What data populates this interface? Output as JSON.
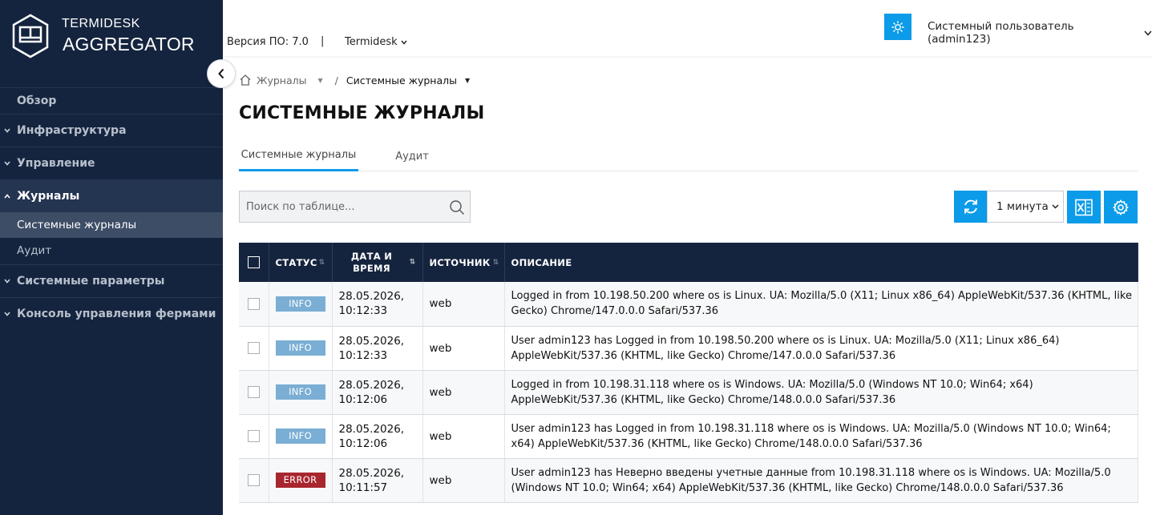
{
  "brand": {
    "line1": "TERMIDESK",
    "line2": "AGGREGATOR"
  },
  "sidebar": {
    "items": [
      {
        "label": "Обзор"
      },
      {
        "label": "Инфраструктура"
      },
      {
        "label": "Управление"
      },
      {
        "label": "Журналы",
        "expanded": true
      },
      {
        "label": "Системные параметры"
      },
      {
        "label": "Консоль управления фермами"
      }
    ],
    "journal_sub": [
      {
        "label": "Системные журналы",
        "active": true
      },
      {
        "label": "Аудит"
      }
    ]
  },
  "header": {
    "version": "Версия ПО: 7.0",
    "separator": "|",
    "org": "Termidesk",
    "user": "Системный пользователь (admin123)"
  },
  "breadcrumb": {
    "parent": "Журналы",
    "separator": "/",
    "current": "Системные журналы"
  },
  "page_title": "СИСТЕМНЫЕ ЖУРНАЛЫ",
  "tabs": [
    {
      "label": "Системные журналы",
      "active": true
    },
    {
      "label": "Аудит"
    }
  ],
  "search": {
    "placeholder": "Поиск по таблице..."
  },
  "toolbar": {
    "interval": "1 минута"
  },
  "table": {
    "columns": {
      "status": "СТАТУС",
      "date": "ДАТА И ВРЕМЯ",
      "source": "ИСТОЧНИК",
      "description": "ОПИСАНИЕ"
    },
    "rows": [
      {
        "status": "INFO",
        "level": "info",
        "date": "28.05.2026,",
        "time": "10:12:33",
        "source": "web",
        "description": "Logged in from 10.198.50.200 where os is Linux. UA: Mozilla/5.0 (X11; Linux x86_64) AppleWebKit/537.36 (KHTML, like Gecko) Chrome/147.0.0.0 Safari/537.36"
      },
      {
        "status": "INFO",
        "level": "info",
        "date": "28.05.2026,",
        "time": "10:12:33",
        "source": "web",
        "description": "User admin123 has Logged in from 10.198.50.200 where os is Linux. UA: Mozilla/5.0 (X11; Linux x86_64) AppleWebKit/537.36 (KHTML, like Gecko) Chrome/147.0.0.0 Safari/537.36"
      },
      {
        "status": "INFO",
        "level": "info",
        "date": "28.05.2026,",
        "time": "10:12:06",
        "source": "web",
        "description": "Logged in from 10.198.31.118 where os is Windows. UA: Mozilla/5.0 (Windows NT 10.0; Win64; x64) AppleWebKit/537.36 (KHTML, like Gecko) Chrome/148.0.0.0 Safari/537.36"
      },
      {
        "status": "INFO",
        "level": "info",
        "date": "28.05.2026,",
        "time": "10:12:06",
        "source": "web",
        "description": "User admin123 has Logged in from 10.198.31.118 where os is Windows. UA: Mozilla/5.0 (Windows NT 10.0; Win64; x64) AppleWebKit/537.36 (KHTML, like Gecko) Chrome/148.0.0.0 Safari/537.36"
      },
      {
        "status": "ERROR",
        "level": "error",
        "date": "28.05.2026,",
        "time": "10:11:57",
        "source": "web",
        "description": "User admin123 has Неверно введены учетные данные from 10.198.31.118 where os is Windows. UA: Mozilla/5.0 (Windows NT 10.0; Win64; x64) AppleWebKit/537.36 (KHTML, like Gecko) Chrome/148.0.0.0 Safari/537.36"
      }
    ]
  },
  "colors": {
    "sidebar": "#15243e",
    "accent": "#0b9be8",
    "info": "#7aaed4",
    "error": "#a8262e"
  },
  "icons": [
    "logo-icon",
    "collapse-chevron-icon",
    "sun-icon",
    "chevron-down-icon",
    "home-icon",
    "search-icon",
    "refresh-icon",
    "excel-icon",
    "gear-icon",
    "sort-icon"
  ]
}
